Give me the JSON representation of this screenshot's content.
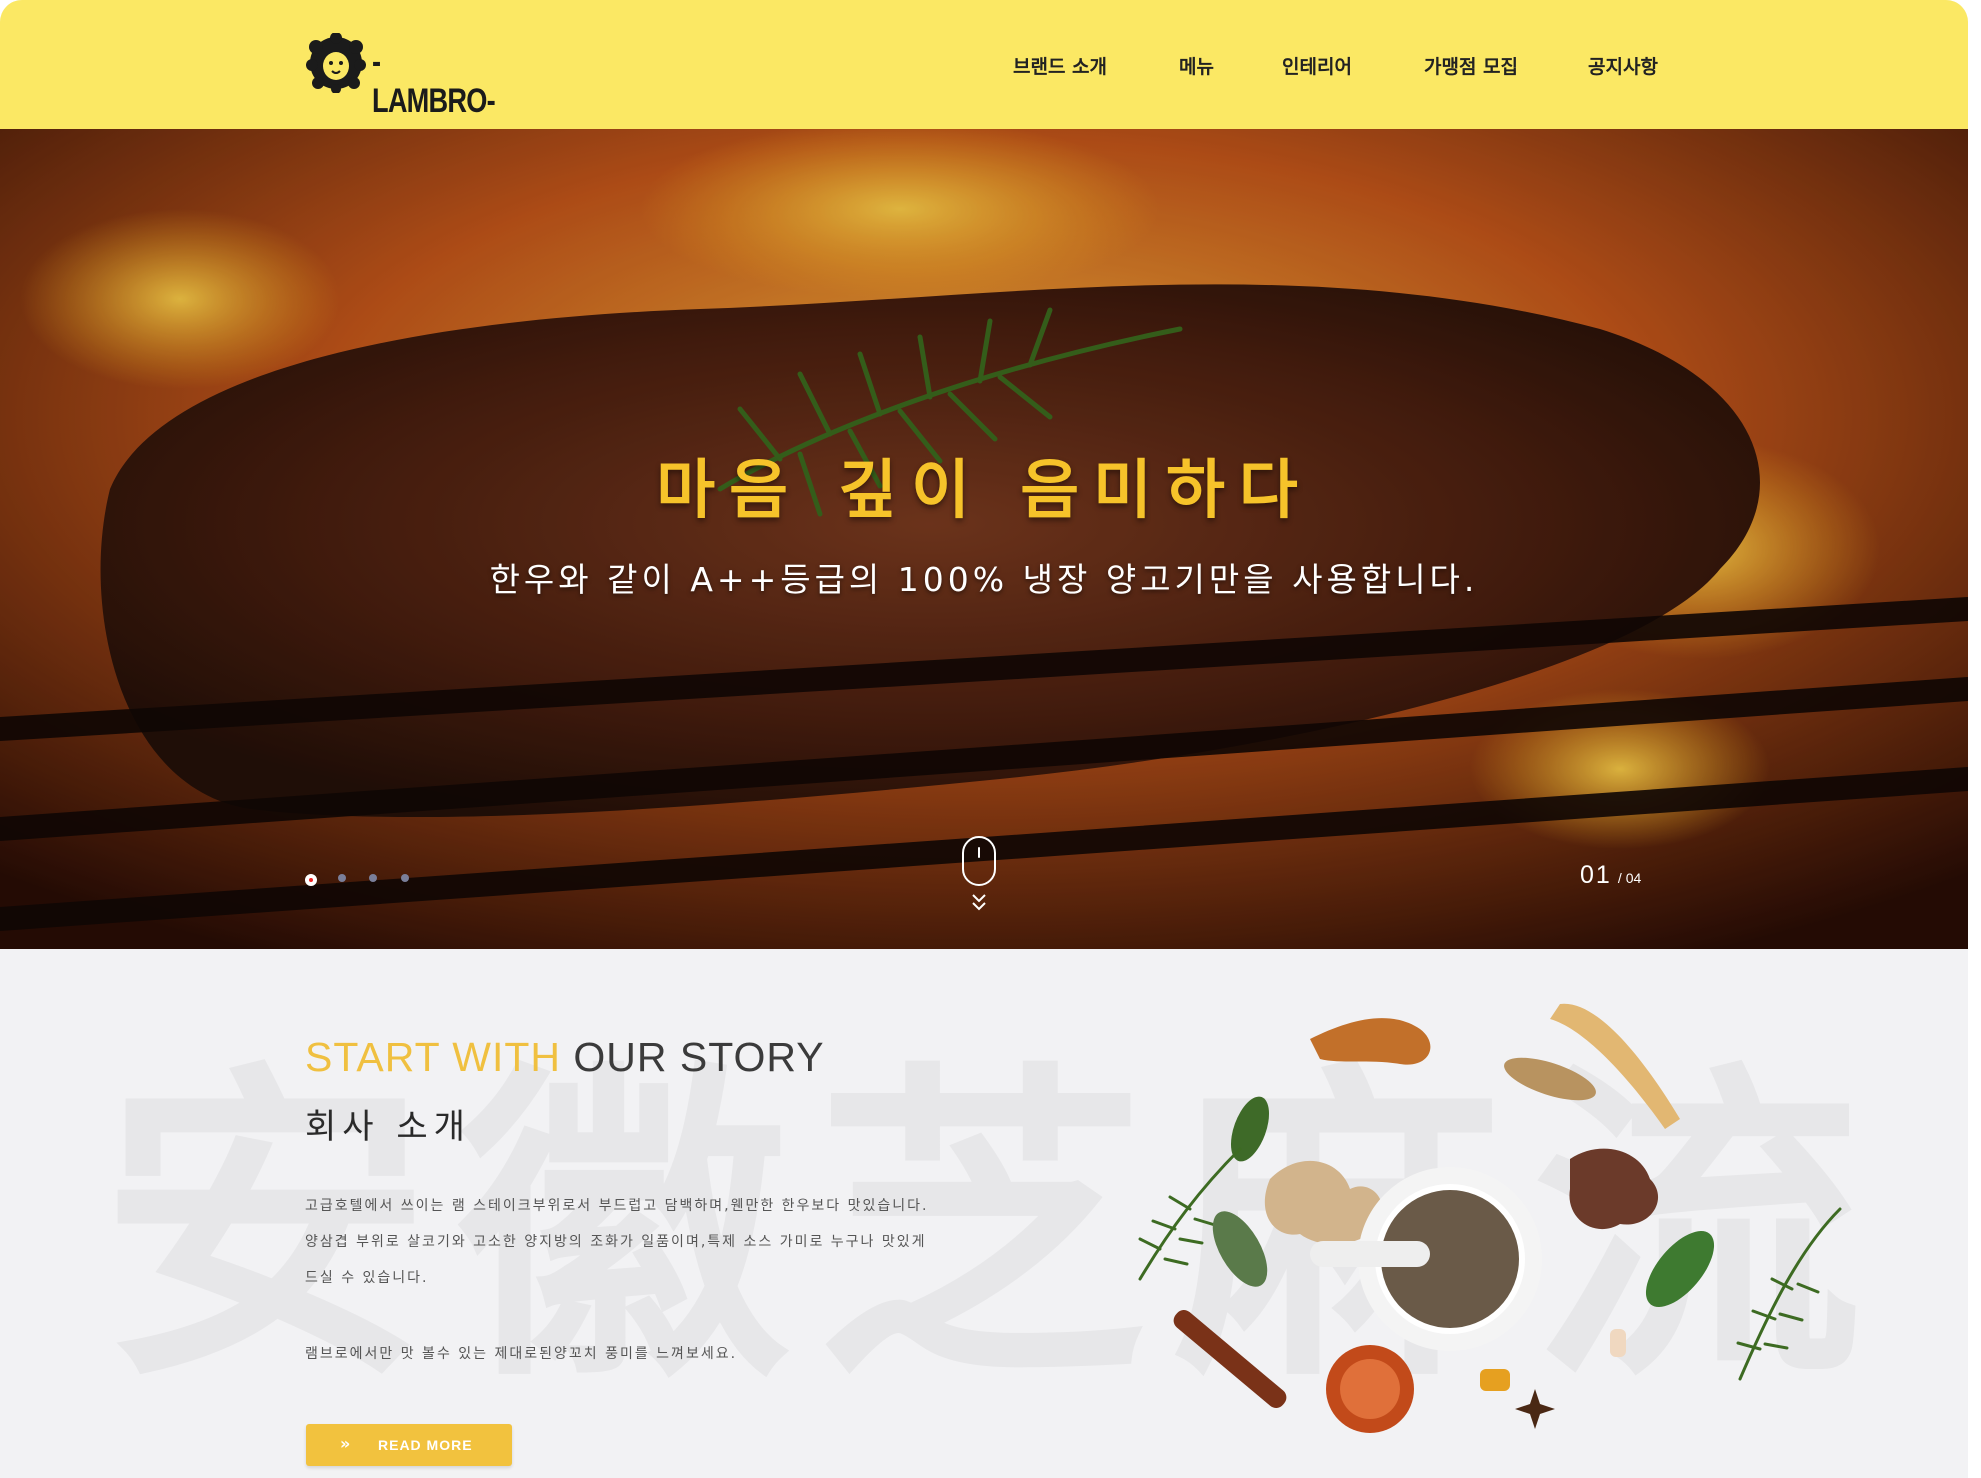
{
  "header": {
    "logo_text": "LAMBRO",
    "nav": [
      {
        "label": "브랜드 소개"
      },
      {
        "label": "메뉴"
      },
      {
        "label": "인테리어"
      },
      {
        "label": "가맹점 모집"
      },
      {
        "label": "공지사항"
      }
    ]
  },
  "hero": {
    "title": "마음 깊이 음미하다",
    "subtitle": "한우와 같이 A++등급의 100% 냉장 양고기만을 사용합니다.",
    "slide_current": "01",
    "slide_separator": "/",
    "slide_total": "04",
    "active_slide": 1,
    "slide_count": 4
  },
  "story": {
    "heading_highlight": "START WITH",
    "heading_rest": " OUR STORY",
    "subheading": "회사 소개",
    "paragraph_lines": [
      "고급호텔에서 쓰이는 램 스테이크부위로서 부드럽고 담백하며,웬만한 한우보다 맛있습니다.",
      "양삼겹 부위로 살코기와 고소한 양지방의 조화가 일품이며,특제 소스 가미로 누구나 맛있게",
      "드실 수 있습니다.",
      "램브로에서만 맛 볼수 있는 제대로된양꼬치 풍미를 느껴보세요."
    ],
    "read_more_label": "READ MORE",
    "read_more_arrows": "»",
    "watermark_text": "安徽芝麻流"
  },
  "colors": {
    "header_bg": "#fbe864",
    "accent_yellow": "#f2c23e",
    "hero_title": "#f6c32a",
    "active_dot": "#e22222"
  },
  "icons": {
    "logo": "lion-head-icon",
    "scroll": "mouse-scroll-icon",
    "scroll_arrows": "double-chevron-down-icon",
    "read_more": "double-arrow-right-icon"
  }
}
